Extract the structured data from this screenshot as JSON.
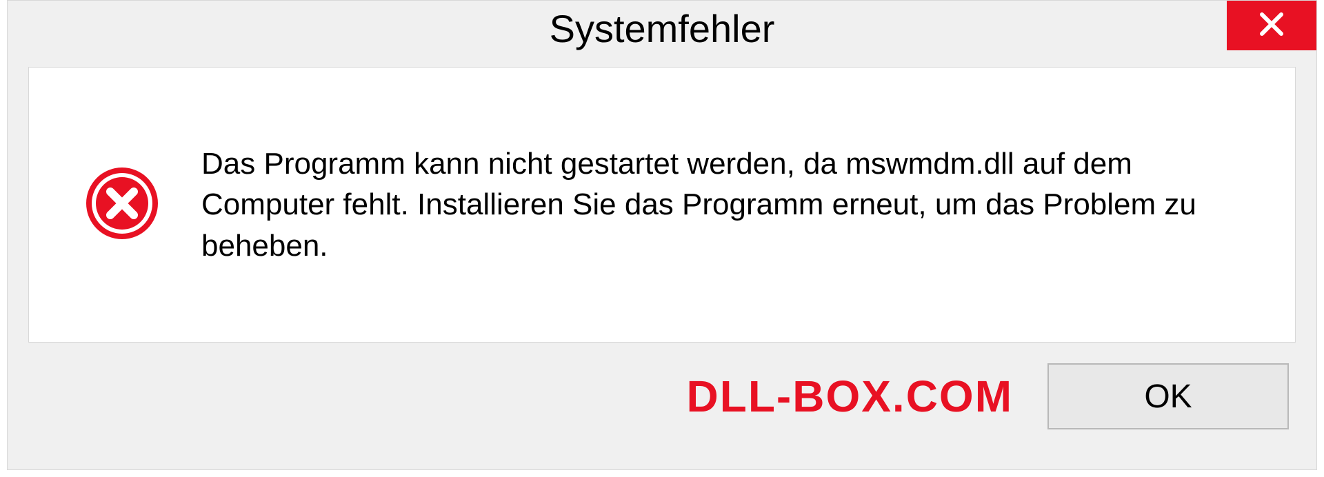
{
  "dialog": {
    "title": "Systemfehler",
    "message": "Das Programm kann nicht gestartet werden, da mswmdm.dll auf dem Computer fehlt. Installieren Sie das Programm erneut, um das Problem zu beheben.",
    "ok_label": "OK"
  },
  "watermark": "DLL-BOX.COM",
  "colors": {
    "error_red": "#e81123",
    "panel_bg": "#f0f0f0",
    "border": "#d8d8d8"
  }
}
